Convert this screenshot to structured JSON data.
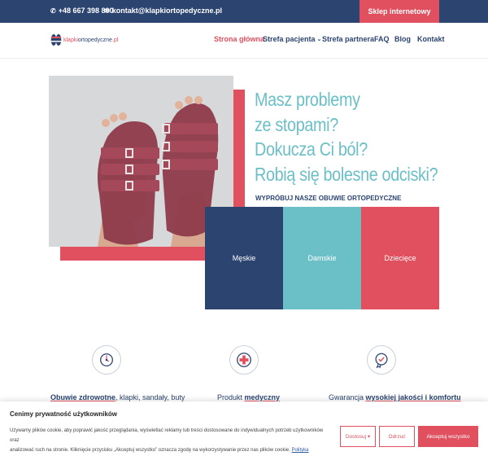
{
  "topbar": {
    "phone": "+48 667 398 800",
    "email": "kontakt@klapkiortopedyczne.pl",
    "shop_button": "Sklep internetowy"
  },
  "logo": {
    "part1": "klapki",
    "part2": "ortopedyczne",
    "part3": ".pl"
  },
  "nav": {
    "items": [
      {
        "label": "Strona główna",
        "active": true
      },
      {
        "label": "Strefa pacjenta",
        "dropdown": true
      },
      {
        "label": "Strefa partnera"
      },
      {
        "label": "FAQ"
      },
      {
        "label": "Blog"
      },
      {
        "label": "Kontakt"
      }
    ]
  },
  "hero": {
    "lines": [
      "Masz problemy",
      "ze stopami?",
      "Dokucza Ci ból?",
      "Robią się bolesne odciski?"
    ],
    "subhead": "WYPRÓBUJ NASZE OBUWIE ORTOPEDYCZNE"
  },
  "categories": [
    "Męskie",
    "Damskie",
    "Dziecięce"
  ],
  "features": [
    {
      "bold": "Obuwie zdrowotne",
      "rest": ", klapki, sandały, buty"
    },
    {
      "pre": "Produkt ",
      "bold": "medyczny"
    },
    {
      "pre": "Gwarancja ",
      "bold": "wysokiej jakości i komfortu"
    }
  ],
  "cookie": {
    "title": "Cenimy prywatność użytkowników",
    "text1": "Używamy plików cookie, aby poprawić jakość przeglądania, wyświetlać reklamy lub treści dostosowane do indywidualnych potrzeb użytkowników oraz",
    "text2": "analizować ruch na stronie. Kliknięcie przycisku „Akceptuj wszystko” oznacza zgodę na wykorzystywanie przez nas plików cookie.",
    "link": "Polityka prywatności",
    "adjust": "Dostosuj",
    "reject": "Odrzuć",
    "accept": "Akceptuj wszystko"
  },
  "colors": {
    "navy": "#2b4470",
    "pink": "#e0505f",
    "teal": "#6bbfc7"
  }
}
